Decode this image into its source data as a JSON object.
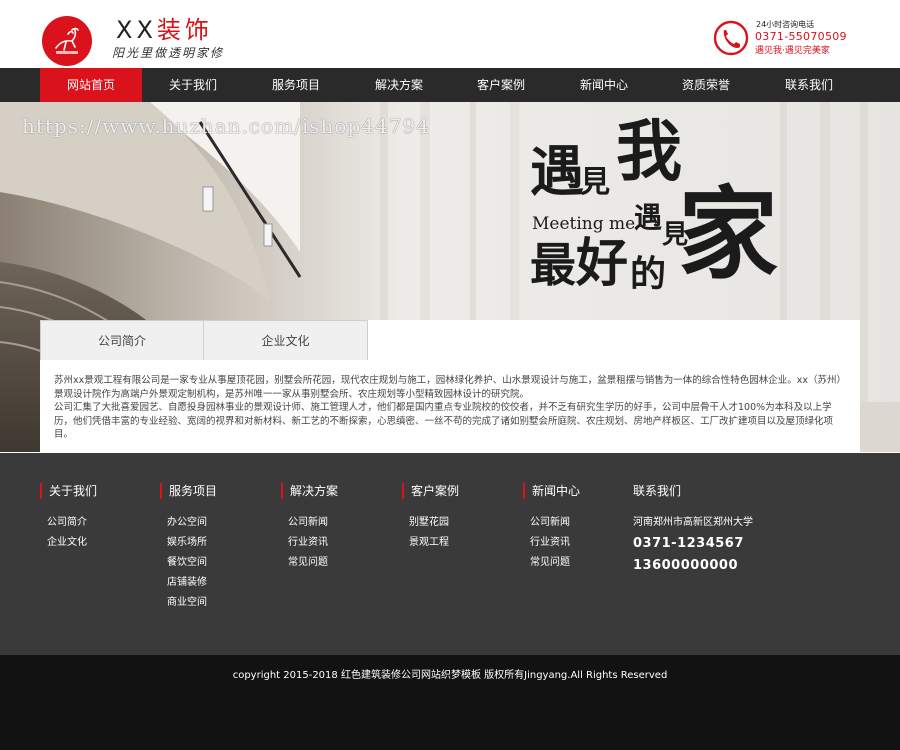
{
  "header": {
    "brand_prefix": "XX",
    "brand_suffix": "装饰",
    "slogan": "阳光里做透明家修",
    "phone_label": "24小时咨询电话",
    "phone_number": "0371-55070509",
    "phone_tagline": "遇见我·遇见完美家"
  },
  "nav": {
    "items": [
      {
        "label": "网站首页",
        "active": true
      },
      {
        "label": "关于我们"
      },
      {
        "label": "服务项目"
      },
      {
        "label": "解决方案"
      },
      {
        "label": "客户案例"
      },
      {
        "label": "新闻中心"
      },
      {
        "label": "资质荣誉"
      },
      {
        "label": "联系我们"
      }
    ]
  },
  "banner": {
    "watermark": "https://www.huzhan.com/ishop44794",
    "slogan_chars": {
      "yu": "遇",
      "jian": "見",
      "wo": "我",
      "meeting": "Meeting me",
      "yu2": "遇",
      "jian2": "見",
      "zui": "最",
      "hao": "好",
      "de": "的",
      "jia": "家"
    }
  },
  "tabs": {
    "items": [
      {
        "label": "公司简介"
      },
      {
        "label": "企业文化"
      }
    ],
    "paragraph_1": "苏州xx景观工程有限公司是一家专业从事屋顶花园，别墅会所花园，现代农庄规划与施工，园林绿化养护、山水景观设计与施工，盆景租摆与销售为一体的综合性特色园林企业。xx（苏州）景观设计院作为高端户外景观定制机构，是苏州唯一一家从事别墅会所、农庄规划等小型精致园林设计的研究院。",
    "paragraph_2": "公司汇集了大批喜爱园艺、自愿投身园林事业的景观设计师、施工管理人才，他们都是国内重点专业院校的佼佼者，并不乏有研究生学历的好手，公司中层骨干人才100%为本科及以上学历，他们凭借丰富的专业经验、宽阔的视界和对新材料、新工艺的不断探索，心思缜密、一丝不苟的完成了诸如别墅会所庭院、农庄规划、房地产样板区、工厂改扩建项目以及屋顶绿化项目。"
  },
  "footer": {
    "columns": [
      {
        "title": "关于我们",
        "links": [
          "公司简介",
          "企业文化"
        ]
      },
      {
        "title": "服务项目",
        "links": [
          "办公空间",
          "娱乐场所",
          "餐饮空间",
          "店铺装修",
          "商业空间"
        ]
      },
      {
        "title": "解决方案",
        "links": [
          "公司新闻",
          "行业资讯",
          "常见问题"
        ]
      },
      {
        "title": "客户案例",
        "links": [
          "别墅花园",
          "景观工程"
        ]
      },
      {
        "title": "新闻中心",
        "links": [
          "公司新闻",
          "行业资讯",
          "常见问题"
        ]
      }
    ],
    "contact": {
      "title": "联系我们",
      "address": "河南郑州市高新区郑州大学",
      "phone1": "0371-1234567",
      "phone2": "13600000000"
    },
    "copyright": "copyright 2015-2018 红色建筑装修公司网站织梦模板 版权所有Jingyang.All Rights Reserved"
  },
  "colors": {
    "brand_red": "#d9121b",
    "nav_bg": "#2a2a2a",
    "footer_bg": "#3a3a3a",
    "copyright_bg": "#121212"
  }
}
